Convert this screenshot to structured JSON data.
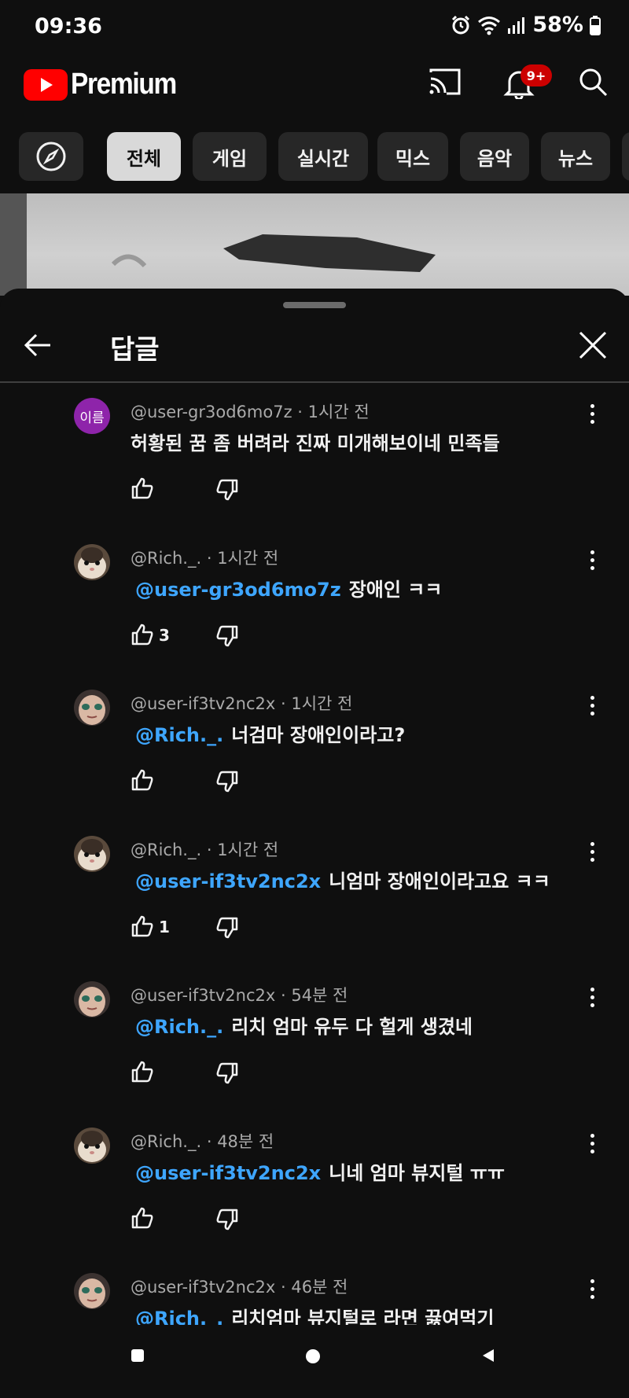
{
  "status_bar": {
    "time": "09:36",
    "battery": "58%"
  },
  "header": {
    "logo_text": "Premium",
    "notification_badge": "9+"
  },
  "chips": [
    "전체",
    "게임",
    "실시간",
    "믹스",
    "음악",
    "뉴스"
  ],
  "panel": {
    "title": "답글"
  },
  "comments": [
    {
      "author": "@user-gr3od6mo7z",
      "time": "1시간 전",
      "mention": "",
      "text": "허황된 꿈 좀 버려라 진짜 미개해보이네 민족들",
      "likes": "",
      "avatar": "purple",
      "avatar_text": "이름"
    },
    {
      "author": "@Rich._.",
      "time": "1시간 전",
      "mention": "@user-gr3od6mo7z",
      "text": "장애인 ㅋㅋ",
      "likes": "3",
      "avatar": "hamster"
    },
    {
      "author": "@user-if3tv2nc2x",
      "time": "1시간 전",
      "mention": "@Rich._.",
      "text": "너검마 장애인이라고?",
      "likes": "",
      "avatar": "face"
    },
    {
      "author": "@Rich._.",
      "time": "1시간 전",
      "mention": "@user-if3tv2nc2x",
      "text": "니엄마 장애인이라고요 ㅋㅋ",
      "likes": "1",
      "avatar": "hamster"
    },
    {
      "author": "@user-if3tv2nc2x",
      "time": "54분 전",
      "mention": "@Rich._.",
      "text": "리치 엄마 유두 다 헐게 생겼네",
      "likes": "",
      "avatar": "face"
    },
    {
      "author": "@Rich._.",
      "time": "48분 전",
      "mention": "@user-if3tv2nc2x",
      "text": "니네 엄마 뷰지털 ㅠㅠ",
      "likes": "",
      "avatar": "hamster"
    },
    {
      "author": "@user-if3tv2nc2x",
      "time": "46분 전",
      "mention": "@Rich._.",
      "text": "리치엄마 뷰지털로 라면 끓여먹기",
      "likes": "",
      "avatar": "face"
    }
  ],
  "colors": {
    "background": "#0f0f0f",
    "mention": "#3ea6ff",
    "youtube_red": "#ff0000",
    "badge": "#cc0000"
  },
  "icons": [
    "cast-icon",
    "bell-icon",
    "search-icon",
    "explore-icon",
    "back-arrow-icon",
    "close-icon",
    "more-vert-icon",
    "thumb-up-icon",
    "thumb-down-icon"
  ]
}
